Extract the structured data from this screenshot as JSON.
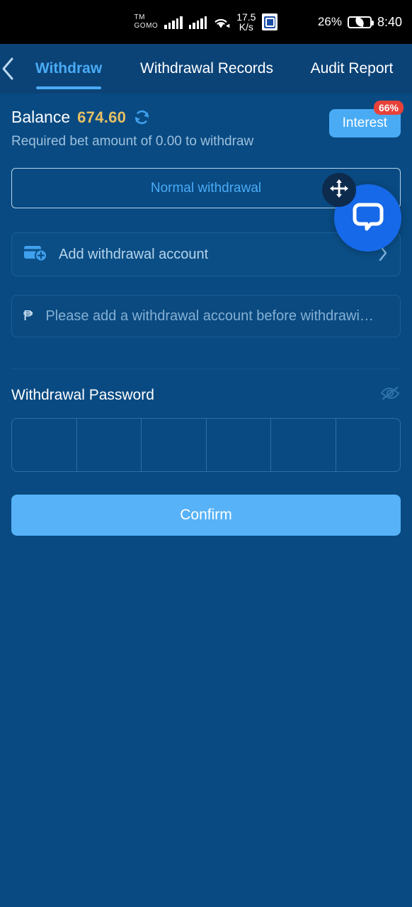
{
  "status_bar": {
    "carrier_line1": "TM",
    "carrier_line2": "GOMO",
    "data_rate_value": "17.5",
    "data_rate_unit": "K/s",
    "battery_percent": "26%",
    "time": "8:40"
  },
  "nav": {
    "back_icon": "chevron-left-icon",
    "tabs": [
      {
        "label": "Withdraw",
        "active": true
      },
      {
        "label": "Withdrawal Records",
        "active": false
      },
      {
        "label": "Audit Report",
        "active": false
      }
    ]
  },
  "balance": {
    "label": "Balance",
    "amount": "674.60",
    "refresh_icon": "refresh-icon",
    "requirement_text": "Required bet amount of 0.00 to withdraw",
    "interest_label": "Interest",
    "interest_badge": "66%"
  },
  "withdrawal_type": {
    "selected": "Normal withdrawal"
  },
  "account": {
    "label": "Add withdrawal account",
    "icon": "card-add-icon",
    "chevron": "chevron-right-icon"
  },
  "amount_field": {
    "currency_symbol": "₱",
    "placeholder": "Please add a withdrawal account before withdrawi…"
  },
  "password": {
    "label": "Withdrawal Password",
    "visibility_icon": "eye-slash-icon",
    "cells": [
      "",
      "",
      "",
      "",
      "",
      ""
    ]
  },
  "confirm": {
    "label": "Confirm"
  },
  "floating": {
    "chat_icon": "chat-bubble-icon",
    "move_icon": "move-handle-icon"
  },
  "colors": {
    "page_bg": "#094a82",
    "nav_bg": "#0b4377",
    "accent_blue": "#4aabf5",
    "amount_gold": "#e6c163",
    "badge_red": "#e8413a",
    "confirm_blue": "#57b2f7",
    "fab_blue": "#1669e8"
  }
}
